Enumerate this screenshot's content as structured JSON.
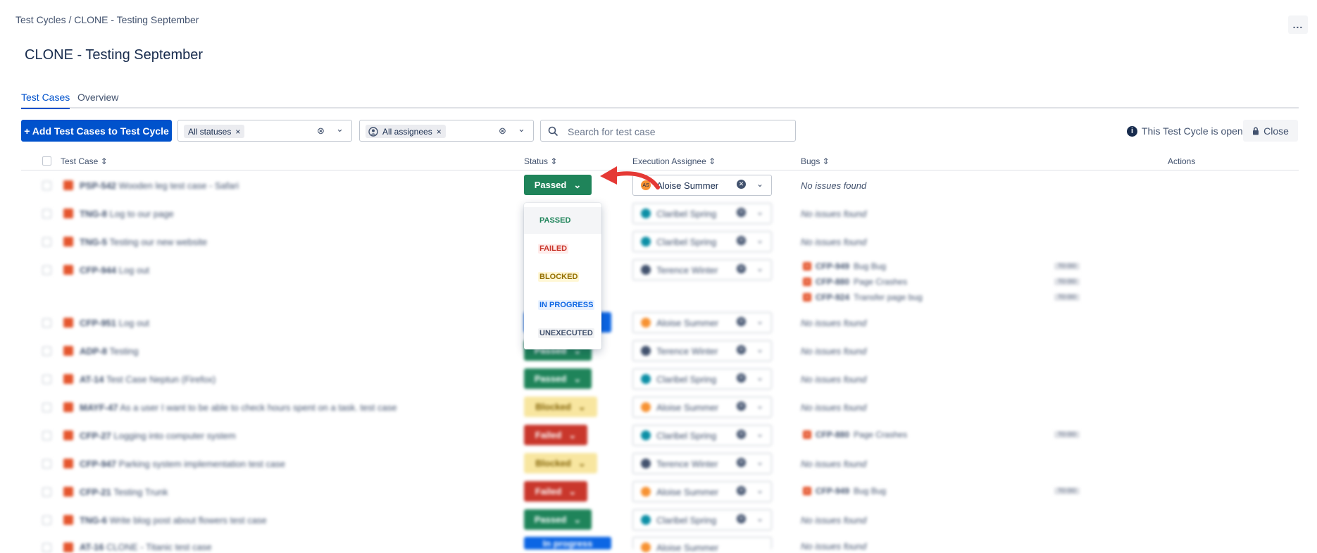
{
  "breadcrumb": "Test Cycles / CLONE - Testing September",
  "more_label": "...",
  "page_title": "CLONE - Testing September",
  "tabs": [
    {
      "label": "Test Cases",
      "active": true
    },
    {
      "label": "Overview",
      "active": false
    }
  ],
  "toolbar": {
    "add_label": "+ Add Test Cases to Test Cycle",
    "status_filter_tag": "All statuses",
    "assignee_filter_tag": "All assignees",
    "tag_remove": "×",
    "clear_icon": "⊗",
    "chevron": "⌄",
    "search_placeholder": "Search for test case",
    "open_note": "This Test Cycle is open",
    "close_label": "Close"
  },
  "columns": {
    "test_case": "Test Case ⇕",
    "status": "Status ⇕",
    "assignee": "Execution Assignee ⇕",
    "bugs": "Bugs ⇕",
    "actions": "Actions"
  },
  "rows": [
    {
      "key": "PSP-542",
      "title": "Wooden leg test case - Safari",
      "status": "Passed",
      "assignee": "Aloise Summer",
      "avatar_initials": "AS",
      "bugs_text": "No issues found"
    },
    {
      "key": "TNG-8",
      "title": "Log to our page",
      "status": "",
      "assignee": "Claribel Spring",
      "bugs_text": "No issues found"
    },
    {
      "key": "TNG-5",
      "title": "Testing our new website",
      "status": "",
      "assignee": "Claribel Spring",
      "bugs_text": "No issues found"
    },
    {
      "key": "CFP-944",
      "title": "Log out",
      "status": "",
      "assignee": "Terence Winter",
      "bugs": [
        {
          "key": "CFP-949",
          "title": "Bug Bug",
          "state": "TO DO"
        },
        {
          "key": "CFP-880",
          "title": "Page Crashes",
          "state": "TO DO"
        },
        {
          "key": "CFP-924",
          "title": "Transfer page bug",
          "state": "TO DO"
        }
      ]
    },
    {
      "key": "CFP-951",
      "title": "Log out",
      "status": "",
      "assignee": "Aloise Summer",
      "bugs_text": "No issues found"
    },
    {
      "key": "ADP-8",
      "title": "Testing",
      "status": "Passed",
      "assignee": "Terence Winter",
      "bugs_text": "No issues found"
    },
    {
      "key": "AT-14",
      "title": "Test Case Neptun (Firefox)",
      "status": "Passed",
      "assignee": "Claribel Spring",
      "bugs_text": "No issues found"
    },
    {
      "key": "MAYF-47",
      "title": "As a user I want to be able to check hours spent on a task. test case",
      "status": "Blocked",
      "assignee": "Aloise Summer",
      "bugs_text": "No issues found"
    },
    {
      "key": "CFP-27",
      "title": "Logging into computer system",
      "status": "Failed",
      "assignee": "Claribel Spring",
      "bugs": [
        {
          "key": "CFP-880",
          "title": "Page Crashes",
          "state": "TO DO"
        }
      ]
    },
    {
      "key": "CFP-947",
      "title": "Parking system implementation test case",
      "status": "Blocked",
      "assignee": "Terence Winter",
      "bugs_text": "No issues found"
    },
    {
      "key": "CFP-21",
      "title": "Testing Trunk",
      "status": "Failed",
      "assignee": "Aloise Summer",
      "bugs": [
        {
          "key": "CFP-949",
          "title": "Bug Bug",
          "state": "TO DO"
        }
      ]
    },
    {
      "key": "TNG-6",
      "title": "Write blog post about flowers test case",
      "status": "Passed",
      "assignee": "Claribel Spring",
      "bugs_text": "No issues found"
    },
    {
      "key": "AT-16",
      "title": "CLONE - Titanic test case",
      "status": "In progress",
      "assignee": "Aloise Summer",
      "bugs_text": "No issues found"
    }
  ],
  "status_dropdown": {
    "options": [
      {
        "label": "PASSED",
        "color": "#1f845a",
        "bg": "transparent"
      },
      {
        "label": "FAILED",
        "color": "#c9372c",
        "bg": "#ffeceb"
      },
      {
        "label": "BLOCKED",
        "color": "#946f00",
        "bg": "#fff7d6"
      },
      {
        "label": "IN PROGRESS",
        "color": "#0c66e4",
        "bg": "#e9f2ff"
      },
      {
        "label": "UNEXECUTED",
        "color": "#44546f",
        "bg": "#f1f2f4"
      }
    ]
  },
  "colors": {
    "primary": "#0052cc",
    "passed": "#1f845a",
    "failed": "#c9372c",
    "blocked": "#f8e6a0",
    "in_progress": "#0c66e4",
    "annotation_arrow": "#e53935",
    "avatar_aloise": "#f79232",
    "avatar_claribel": "#0c8fa6",
    "avatar_terence": "#42526e"
  }
}
